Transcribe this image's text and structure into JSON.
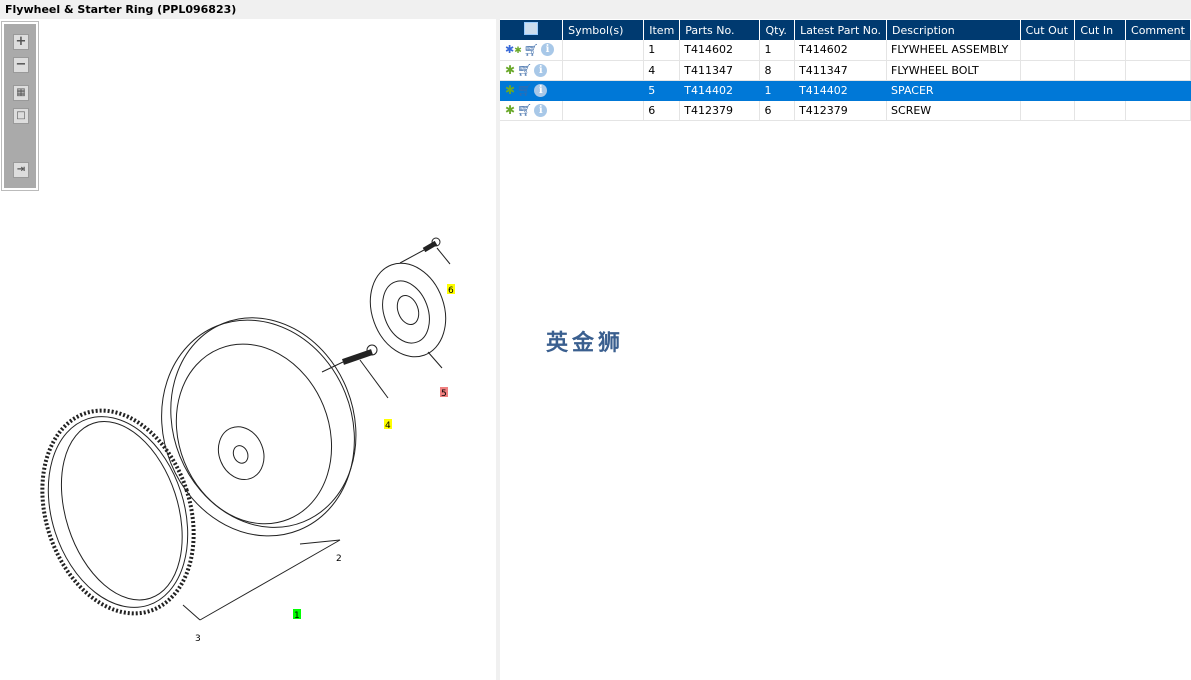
{
  "window": {
    "title": "Flywheel & Starter Ring (PPL096823)"
  },
  "toolbar": {
    "zoom_in": "+",
    "zoom_out": "−",
    "fit_all": "▦",
    "fit_window": "□",
    "toggle_panel": "⇥"
  },
  "diagram": {
    "callouts": [
      {
        "label": "1",
        "highlight": "#00ff00"
      },
      {
        "label": "2",
        "highlight": ""
      },
      {
        "label": "3",
        "highlight": ""
      },
      {
        "label": "4",
        "highlight": "#ffff00"
      },
      {
        "label": "5",
        "highlight": "#f08080"
      },
      {
        "label": "6",
        "highlight": "#ffff00"
      }
    ]
  },
  "watermark": "英金狮",
  "table": {
    "headers": [
      "",
      "Symbol(s)",
      "Item",
      "Parts No.",
      "Qty.",
      "Latest Part No.",
      "Description",
      "Cut Out",
      "Cut In",
      "Comment"
    ],
    "rows": [
      {
        "item": "1",
        "part": "T414602",
        "qty": "1",
        "latest": "T414602",
        "desc": "FLYWHEEL ASSEMBLY",
        "icon": "assembly-gears-icon"
      },
      {
        "item": "4",
        "part": "T411347",
        "qty": "8",
        "latest": "T411347",
        "desc": "FLYWHEEL BOLT",
        "icon": "gear-icon"
      },
      {
        "item": "5",
        "part": "T414402",
        "qty": "1",
        "latest": "T414402",
        "desc": "SPACER",
        "icon": "gear-icon",
        "selected": true
      },
      {
        "item": "6",
        "part": "T412379",
        "qty": "6",
        "latest": "T412379",
        "desc": "SCREW",
        "icon": "gear-icon"
      }
    ]
  },
  "colors": {
    "header": "#003a70",
    "selected": "#0078d7"
  }
}
